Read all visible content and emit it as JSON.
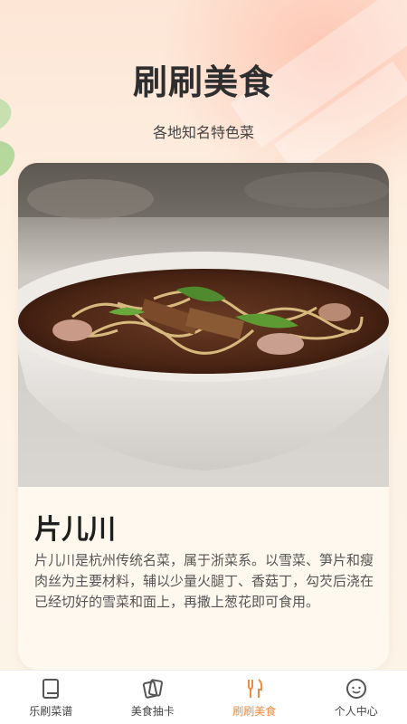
{
  "header": {
    "title": "刷刷美食",
    "subtitle": "各地知名特色菜"
  },
  "card": {
    "image_alt": "bowl of noodle soup",
    "dish_name": "片儿川",
    "description": "片儿川是杭州传统名菜，属于浙菜系。以雪菜、笋片和瘦肉丝为主要材料，辅以少量火腿丁、香菇丁，勾芡后浇在已经切好的雪菜和面上，再撒上葱花即可食用。"
  },
  "tabbar": {
    "items": [
      {
        "label": "乐刷菜谱",
        "icon": "book-icon",
        "active": false
      },
      {
        "label": "美食抽卡",
        "icon": "cards-icon",
        "active": false
      },
      {
        "label": "刷刷美食",
        "icon": "fork-knife-icon",
        "active": true
      },
      {
        "label": "个人中心",
        "icon": "face-icon",
        "active": false
      }
    ]
  },
  "colors": {
    "accent": "#f08a3c",
    "background": "#fdf1e3",
    "card": "#fff8ee"
  }
}
